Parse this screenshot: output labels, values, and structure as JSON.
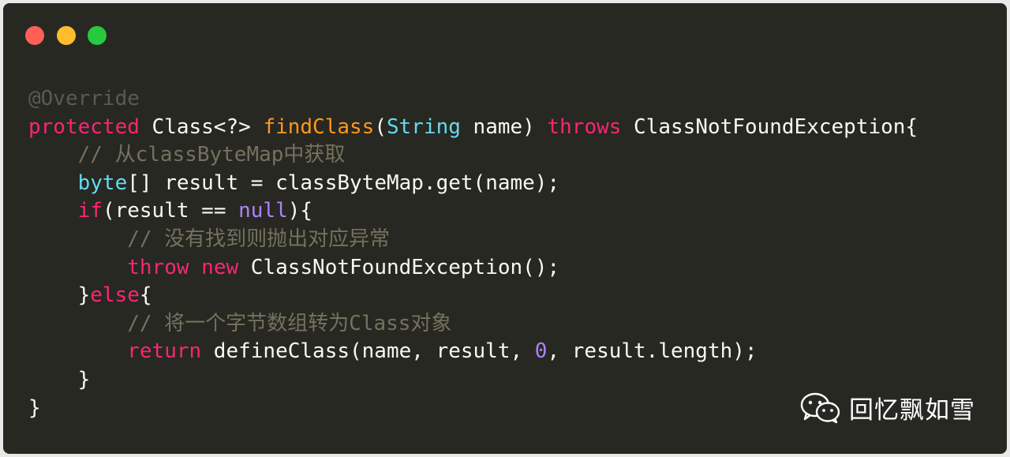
{
  "window": {
    "controls": [
      {
        "name": "close",
        "color": "#ff5f56"
      },
      {
        "name": "minimize",
        "color": "#ffbd2e"
      },
      {
        "name": "maximize",
        "color": "#27c93f"
      }
    ]
  },
  "code": {
    "language": "java",
    "lines": [
      [
        {
          "t": "annotation",
          "v": "@Override"
        }
      ],
      [
        {
          "t": "keyword",
          "v": "protected"
        },
        {
          "t": "plain",
          "v": " Class<?> "
        },
        {
          "t": "func",
          "v": "findClass"
        },
        {
          "t": "plain",
          "v": "("
        },
        {
          "t": "type",
          "v": "String"
        },
        {
          "t": "plain",
          "v": " name) "
        },
        {
          "t": "keyword",
          "v": "throws"
        },
        {
          "t": "plain",
          "v": " ClassNotFoundException{"
        }
      ],
      [
        {
          "t": "comment",
          "v": "    // 从classByteMap中获取"
        }
      ],
      [
        {
          "t": "plain",
          "v": "    "
        },
        {
          "t": "type",
          "v": "byte"
        },
        {
          "t": "plain",
          "v": "[] result = classByteMap.get(name);"
        }
      ],
      [
        {
          "t": "plain",
          "v": "    "
        },
        {
          "t": "keyword",
          "v": "if"
        },
        {
          "t": "plain",
          "v": "(result == "
        },
        {
          "t": "literal",
          "v": "null"
        },
        {
          "t": "plain",
          "v": "){"
        }
      ],
      [
        {
          "t": "comment",
          "v": "        // 没有找到则抛出对应异常"
        }
      ],
      [
        {
          "t": "plain",
          "v": "        "
        },
        {
          "t": "keyword",
          "v": "throw"
        },
        {
          "t": "plain",
          "v": " "
        },
        {
          "t": "keyword",
          "v": "new"
        },
        {
          "t": "plain",
          "v": " ClassNotFoundException();"
        }
      ],
      [
        {
          "t": "plain",
          "v": "    }"
        },
        {
          "t": "keyword",
          "v": "else"
        },
        {
          "t": "plain",
          "v": "{"
        }
      ],
      [
        {
          "t": "comment",
          "v": "        // 将一个字节数组转为Class对象"
        }
      ],
      [
        {
          "t": "plain",
          "v": "        "
        },
        {
          "t": "keyword",
          "v": "return"
        },
        {
          "t": "plain",
          "v": " defineClass(name, result, "
        },
        {
          "t": "literal",
          "v": "0"
        },
        {
          "t": "plain",
          "v": ", result.length);"
        }
      ],
      [
        {
          "t": "plain",
          "v": "    }"
        }
      ],
      [
        {
          "t": "plain",
          "v": "}"
        }
      ]
    ]
  },
  "watermark": {
    "icon": "wechat-icon",
    "text": "回忆飘如雪"
  }
}
